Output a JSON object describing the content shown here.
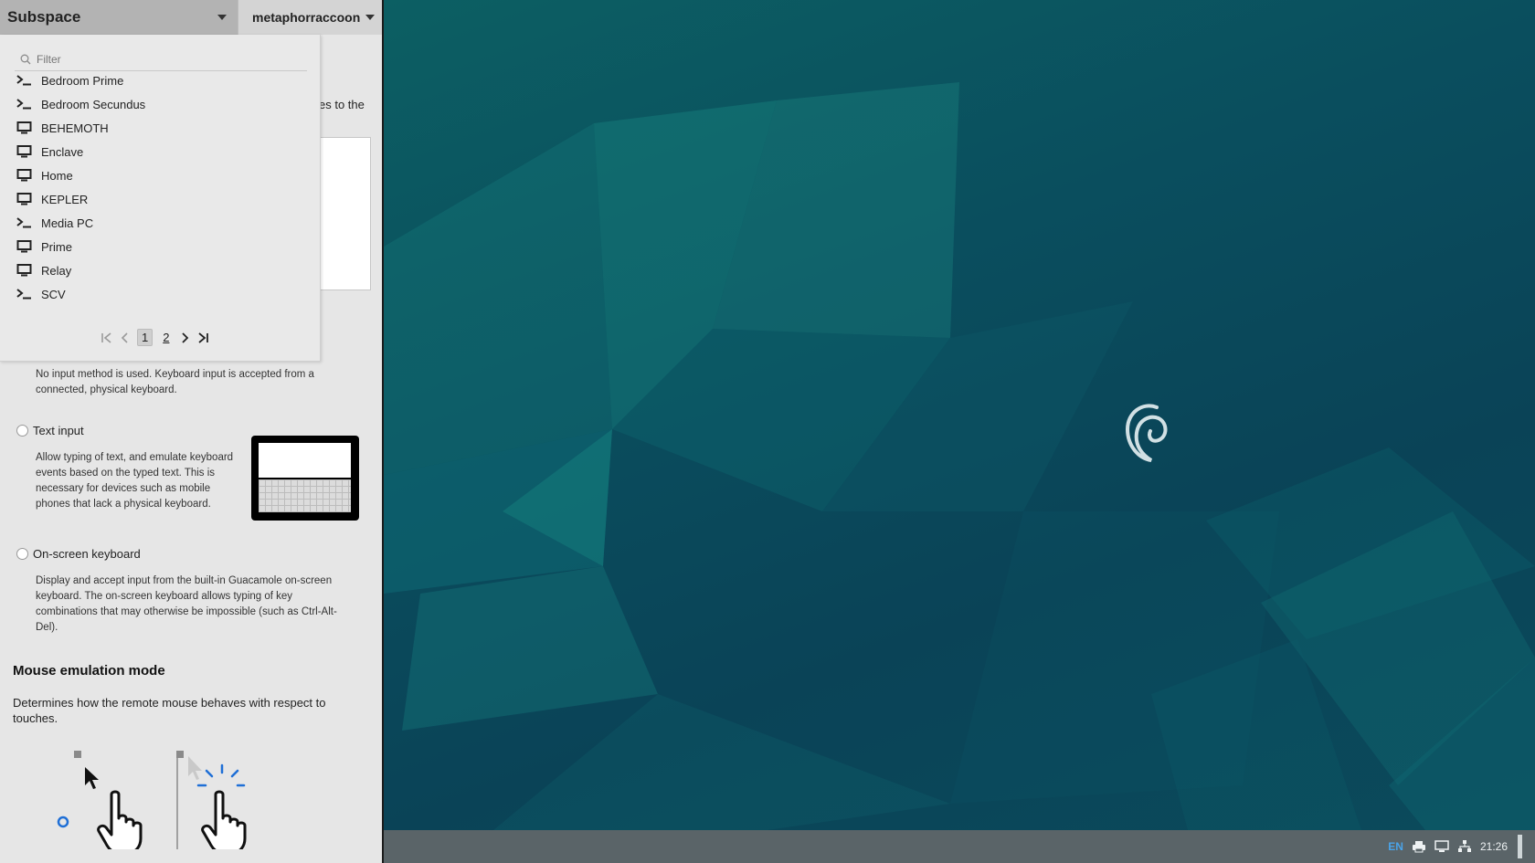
{
  "header": {
    "connection_title": "Subspace",
    "username": "metaphorraccoon"
  },
  "dropdown": {
    "filter_placeholder": "Filter",
    "connections": [
      {
        "label": "Bedroom Prime",
        "icon": "terminal-icon"
      },
      {
        "label": "Bedroom Secundus",
        "icon": "terminal-icon"
      },
      {
        "label": "BEHEMOTH",
        "icon": "monitor-icon"
      },
      {
        "label": "Enclave",
        "icon": "monitor-icon"
      },
      {
        "label": "Home",
        "icon": "monitor-icon"
      },
      {
        "label": "KEPLER",
        "icon": "monitor-icon"
      },
      {
        "label": "Media PC",
        "icon": "terminal-icon"
      },
      {
        "label": "Prime",
        "icon": "monitor-icon"
      },
      {
        "label": "Relay",
        "icon": "monitor-icon"
      },
      {
        "label": "SCV",
        "icon": "terminal-icon"
      }
    ],
    "pager": {
      "current": "1",
      "other": "2"
    }
  },
  "panel": {
    "clipboard_fragment": "es to the",
    "input_none_desc": "No input method is used. Keyboard input is accepted from a connected, physical keyboard.",
    "text_input": {
      "title": "Text input",
      "desc": "Allow typing of text, and emulate keyboard events based on the typed text. This is necessary for devices such as mobile phones that lack a physical keyboard."
    },
    "osk": {
      "title": "On-screen keyboard",
      "desc": "Display and accept input from the built-in Guacamole on-screen keyboard. The on-screen keyboard allows typing of key combinations that may otherwise be impossible (such as Ctrl-Alt-Del)."
    },
    "mouse_section": {
      "title": "Mouse emulation mode",
      "desc": "Determines how the remote mouse behaves with respect to touches."
    }
  },
  "taskbar": {
    "language": "EN",
    "time": "21:26"
  },
  "colors": {
    "accent_blue": "#4aa3e8",
    "radio_blue": "#1f6fd6"
  }
}
